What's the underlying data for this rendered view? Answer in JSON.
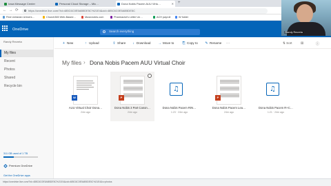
{
  "browser": {
    "tabs": [
      {
        "label": "Iowa Message Center",
        "color": "#1e8e3e"
      },
      {
        "label": "Personal Cloud Storage – Mic…",
        "color": "#0364b8"
      },
      {
        "label": "Dona Nobis Pacem AUU Virtu…",
        "color": "#0364b8"
      }
    ],
    "url": "https://onedrive.live.com/?id=485C6C0E5AB5DE5C%21E4&cid=485C6C0E5AB5DE5C",
    "nav_back": "←",
    "nav_forward": "→",
    "nav_reload": "⟳",
    "bookmarks": [
      {
        "label": "First Unitarian Univers…",
        "color": "#5b9bd5"
      },
      {
        "label": "Church365 Web-Based…",
        "color": "#f4b400"
      },
      {
        "label": "Musicnotes.com",
        "color": "#db4437"
      },
      {
        "label": "Pharmacist's Letter Un…",
        "color": "#7b1fa2"
      },
      {
        "label": "ACH payroll",
        "color": "#0f9d58"
      },
      {
        "label": "W folder",
        "color": "#4285f4"
      }
    ],
    "status_url": "https://onedrive.live.com/?id=485C6C0E5AB5DE5C%21E4&cid=485C6C0E5AB5DE5C%21E4&v=photos"
  },
  "header": {
    "brand": "OneDrive",
    "search_placeholder": "Search everything"
  },
  "webcam": {
    "name": "Randy Recreta"
  },
  "sidebar": {
    "user": "Randy Recreta",
    "items": [
      {
        "label": "My files",
        "active": true
      },
      {
        "label": "Recent",
        "active": false
      },
      {
        "label": "Photos",
        "active": false
      },
      {
        "label": "Shared",
        "active": false
      },
      {
        "label": "Recycle bin",
        "active": false
      }
    ],
    "storage": "311 GB used of 1 TB",
    "storage_fraction": 0.3,
    "premium": "Premium OneDrive",
    "get_apps": "Get the OneDrive apps"
  },
  "commands": [
    {
      "label": "New",
      "icon": "+"
    },
    {
      "label": "Upload",
      "icon": "↑"
    },
    {
      "label": "Share",
      "icon": "⇪"
    },
    {
      "label": "Download",
      "icon": "↓"
    },
    {
      "label": "Move to",
      "icon": "→"
    },
    {
      "label": "Copy to",
      "icon": "⎘"
    },
    {
      "label": "Rename",
      "icon": "✎"
    }
  ],
  "right_commands": {
    "sort": "Sort",
    "view": "⊞"
  },
  "breadcrumb": {
    "root": "My files",
    "sep": "›",
    "current": "Dona Nobis Pacem AUU Virtual Choir"
  },
  "files": [
    {
      "name": "AUU Virtual Choir Dona…",
      "meta": "24m ago",
      "kind": "doc"
    },
    {
      "name": "Dona Nobis 3 Part Canon…",
      "meta": "24m ago",
      "kind": "score"
    },
    {
      "name": "Dona Nobis Pacem RIN…",
      "meta": "1:23 · 24m ago",
      "kind": "audio"
    },
    {
      "name": "Dona Nobis Pacem Lea…",
      "meta": "24m ago",
      "kind": "score"
    },
    {
      "name": "Dona Nobis Pacem R+C…",
      "meta": "1:21 · 24m ago",
      "kind": "audio"
    }
  ]
}
